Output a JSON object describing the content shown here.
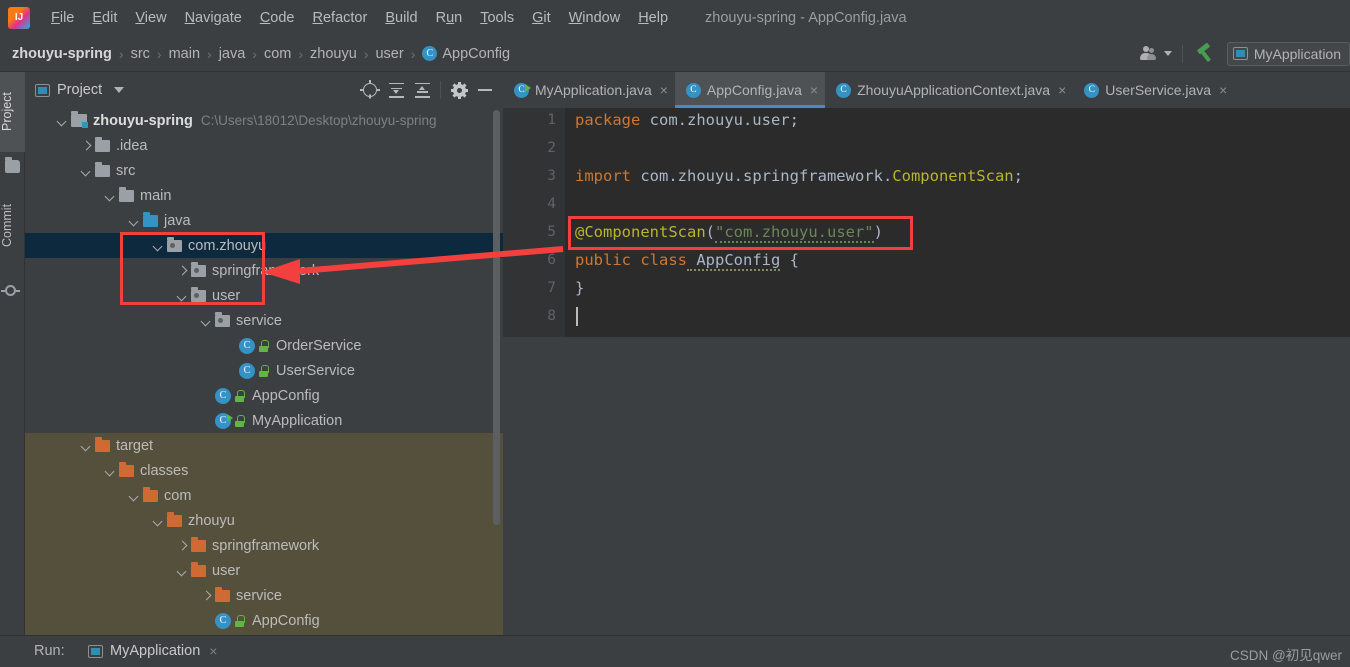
{
  "window": {
    "title": "zhouyu-spring - AppConfig.java",
    "logo_icon": "intellij-idea-logo"
  },
  "menubar": {
    "items": [
      {
        "label": "File",
        "mnemonic": "F"
      },
      {
        "label": "Edit",
        "mnemonic": "E"
      },
      {
        "label": "View",
        "mnemonic": "V"
      },
      {
        "label": "Navigate",
        "mnemonic": "N"
      },
      {
        "label": "Code",
        "mnemonic": "C"
      },
      {
        "label": "Refactor",
        "mnemonic": "R"
      },
      {
        "label": "Build",
        "mnemonic": "B"
      },
      {
        "label": "Run",
        "mnemonic": "u"
      },
      {
        "label": "Tools",
        "mnemonic": "T"
      },
      {
        "label": "Git",
        "mnemonic": "G"
      },
      {
        "label": "Window",
        "mnemonic": "W"
      },
      {
        "label": "Help",
        "mnemonic": "H"
      }
    ]
  },
  "navbar": {
    "crumbs": [
      "zhouyu-spring",
      "src",
      "main",
      "java",
      "com",
      "zhouyu",
      "user",
      "AppConfig"
    ],
    "separator": "›",
    "class_badge": "C",
    "right": {
      "people_icon": "people-icon",
      "build_icon": "hammer-build-icon",
      "run_config": "MyApplication",
      "run_config_icon": "run-configuration-icon"
    }
  },
  "left_strip": {
    "tabs": [
      {
        "label": "Project",
        "icon": "folder-icon",
        "active": true
      },
      {
        "label": "Commit",
        "icon": "commit-icon",
        "active": false
      }
    ]
  },
  "project_panel": {
    "title": "Project",
    "title_icon": "project-view-icon",
    "dropdown_icon": "chevron-down-icon",
    "toolbar": [
      {
        "name": "select-opened-file-icon",
        "icon": "target-icon"
      },
      {
        "name": "expand-all-icon",
        "icon": "expand-all-icon"
      },
      {
        "name": "collapse-all-icon",
        "icon": "collapse-all-icon"
      },
      {
        "name": "settings-icon",
        "icon": "gear-icon"
      },
      {
        "name": "hide-panel-icon",
        "icon": "minus-icon"
      }
    ],
    "tree": [
      {
        "label": "zhouyu-spring",
        "path": "C:\\Users\\18012\\Desktop\\zhouyu-spring",
        "depth": 0,
        "chevron": "down",
        "icon": "project-root",
        "bold": true
      },
      {
        "label": ".idea",
        "depth": 1,
        "chevron": "right",
        "icon": "dir"
      },
      {
        "label": "src",
        "depth": 1,
        "chevron": "down",
        "icon": "dir"
      },
      {
        "label": "main",
        "depth": 2,
        "chevron": "down",
        "icon": "dir"
      },
      {
        "label": "java",
        "depth": 3,
        "chevron": "down",
        "icon": "dir-source"
      },
      {
        "label": "com.zhouyu",
        "depth": 4,
        "chevron": "down",
        "icon": "package",
        "selected": true
      },
      {
        "label": "springframework",
        "depth": 5,
        "chevron": "right",
        "icon": "package"
      },
      {
        "label": "user",
        "depth": 5,
        "chevron": "down",
        "icon": "package"
      },
      {
        "label": "service",
        "depth": 6,
        "chevron": "down",
        "icon": "package"
      },
      {
        "label": "OrderService",
        "depth": 7,
        "chevron": "none",
        "icon": "class"
      },
      {
        "label": "UserService",
        "depth": 7,
        "chevron": "none",
        "icon": "class"
      },
      {
        "label": "AppConfig",
        "depth": 6,
        "chevron": "none",
        "icon": "class"
      },
      {
        "label": "MyApplication",
        "depth": 6,
        "chevron": "none",
        "icon": "class-runnable"
      },
      {
        "label": "target",
        "depth": 1,
        "chevron": "down",
        "icon": "dir-excluded",
        "excluded": true
      },
      {
        "label": "classes",
        "depth": 2,
        "chevron": "down",
        "icon": "dir-excluded",
        "excluded": true
      },
      {
        "label": "com",
        "depth": 3,
        "chevron": "down",
        "icon": "dir-excluded",
        "excluded": true
      },
      {
        "label": "zhouyu",
        "depth": 4,
        "chevron": "down",
        "icon": "dir-excluded",
        "excluded": true
      },
      {
        "label": "springframework",
        "depth": 5,
        "chevron": "right",
        "icon": "dir-excluded",
        "excluded": true
      },
      {
        "label": "user",
        "depth": 5,
        "chevron": "down",
        "icon": "dir-excluded",
        "excluded": true
      },
      {
        "label": "service",
        "depth": 6,
        "chevron": "right",
        "icon": "dir-excluded",
        "excluded": true
      },
      {
        "label": "AppConfig",
        "depth": 6,
        "chevron": "none",
        "icon": "class",
        "excluded": true
      }
    ]
  },
  "editor": {
    "tabs": [
      {
        "label": "MyApplication.java",
        "icon": "class-runnable",
        "active": false
      },
      {
        "label": "AppConfig.java",
        "icon": "class",
        "active": true
      },
      {
        "label": "ZhouyuApplicationContext.java",
        "icon": "class",
        "active": false
      },
      {
        "label": "UserService.java",
        "icon": "class",
        "active": false
      }
    ],
    "close_glyph": "×",
    "line_numbers": [
      "1",
      "2",
      "3",
      "4",
      "5",
      "6",
      "7",
      "8"
    ],
    "code": {
      "l1_kw": "package",
      "l1_id": " com.zhouyu.user;",
      "l3_kw": "import",
      "l3_id": " com.zhouyu.springframework.",
      "l3_type": "ComponentScan",
      "l3_semi": ";",
      "l5_ann": "@ComponentScan",
      "l5_open": "(",
      "l5_str": "\"com.zhouyu.user\"",
      "l5_close": ")",
      "l6_kw1": "public",
      "l6_kw2": " class",
      "l6_name": " AppConfig",
      "l6_brace": " {",
      "l7": "}"
    }
  },
  "bottom": {
    "run_label": "Run:",
    "run_tab": "MyApplication",
    "run_tab_icon": "run-configuration-icon",
    "close_glyph": "×",
    "watermark": "CSDN @初见qwer"
  },
  "annotations": {
    "color": "#f43f3f",
    "box_tree": "highlight around com.zhouyu / springframework / user packages",
    "box_code": "highlight around @ComponentScan(\"com.zhouyu.user\")",
    "arrow": "arrow from @ComponentScan annotation to springframework package node"
  }
}
